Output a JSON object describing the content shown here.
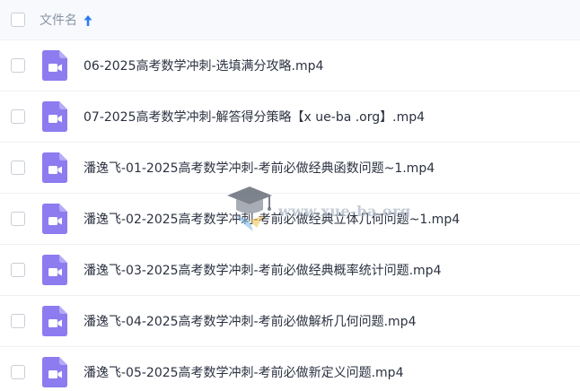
{
  "header": {
    "column_label": "文件名",
    "sort_icon": "arrow-up-icon",
    "sort_color": "#2b7cf0"
  },
  "files": [
    {
      "name": "06-2025高考数学冲刺-选填满分攻略.mp4",
      "icon": "video-file-icon"
    },
    {
      "name": "07-2025高考数学冲刺-解答得分策略【x ue-ba .org】.mp4",
      "icon": "video-file-icon"
    },
    {
      "name": "潘逸飞-01-2025高考数学冲刺-考前必做经典函数问题~1.mp4",
      "icon": "video-file-icon"
    },
    {
      "name": "潘逸飞-02-2025高考数学冲刺-考前必做经典立体几何问题~1.mp4",
      "icon": "video-file-icon"
    },
    {
      "name": "潘逸飞-03-2025高考数学冲刺-考前必做经典概率统计问题.mp4",
      "icon": "video-file-icon"
    },
    {
      "name": "潘逸飞-04-2025高考数学冲刺-考前必做解析几何问题.mp4",
      "icon": "video-file-icon"
    },
    {
      "name": "潘逸飞-05-2025高考数学冲刺-考前必做新定义问题.mp4",
      "icon": "video-file-icon"
    }
  ],
  "watermark": {
    "text": "www.xue-ba.org",
    "icon": "graduation-cap-icon"
  },
  "colors": {
    "video_icon": "#8c7cf0",
    "header_bg": "#f7f9fc"
  }
}
